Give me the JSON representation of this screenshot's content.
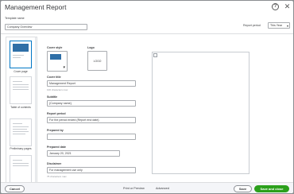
{
  "dialog": {
    "title": "Management Report"
  },
  "template": {
    "label": "Template name",
    "value": "Company Overview"
  },
  "report_period": {
    "label": "Report period",
    "value": "This Year"
  },
  "thumbnails": [
    {
      "label": "Cover page"
    },
    {
      "label": "Table of contents"
    },
    {
      "label": "Preliminary pages"
    }
  ],
  "form": {
    "cover_style_label": "Cover style",
    "logo_label": "Logo",
    "logo_placeholder": "LOGO",
    "cover_title_label": "Cover title",
    "cover_title_value": "Management Report",
    "cover_title_hint": "100 characters max",
    "subtitle_label": "Subtitle",
    "subtitle_value": "{Company name}",
    "report_period_label": "Report period",
    "report_period_value": "For the period ended {Report end date}",
    "prepared_by_label": "Prepared by",
    "prepared_by_value": "",
    "prepared_date_label": "Prepared date",
    "prepared_date_value": "January 20, 2021",
    "disclaimer_label": "Disclaimer",
    "disclaimer_value": "For management use only",
    "disclaimer_hint": "75 characters max"
  },
  "footer": {
    "cancel": "Cancel",
    "print_preview": "Print or Preview",
    "advanced": "Advanced",
    "save": "Save",
    "save_close": "Save and close",
    "caret": "▾"
  },
  "colors": {
    "accent": "#2ca01c",
    "selection": "#0077c5"
  }
}
